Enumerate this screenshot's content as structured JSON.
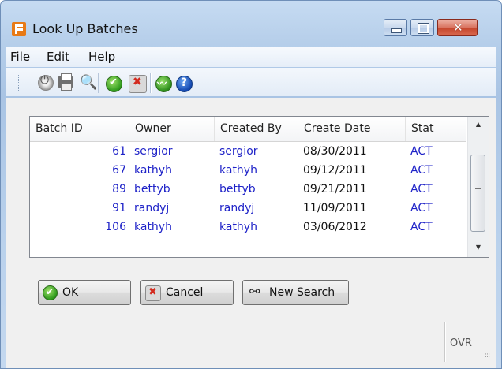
{
  "window": {
    "title": "Look Up Batches",
    "buttons": {
      "minimize": "minimize",
      "maximize": "maximize",
      "close": "✕"
    }
  },
  "menu": [
    "File",
    "Edit",
    "Help"
  ],
  "toolbar": {
    "icons": [
      "power-icon",
      "print-icon",
      "zoom-icon",
      "ok-icon",
      "cancel-icon",
      "chart-icon",
      "help-icon"
    ]
  },
  "table": {
    "columns": [
      "Batch ID",
      "Owner",
      "Created By",
      "Create Date",
      "Stat"
    ],
    "rows": [
      {
        "batch_id": "61",
        "owner": "sergior",
        "created_by": "sergior",
        "create_date": "08/30/2011",
        "stat": "ACT"
      },
      {
        "batch_id": "67",
        "owner": "kathyh",
        "created_by": "kathyh",
        "create_date": "09/12/2011",
        "stat": "ACT"
      },
      {
        "batch_id": "89",
        "owner": "bettyb",
        "created_by": "bettyb",
        "create_date": "09/21/2011",
        "stat": "ACT"
      },
      {
        "batch_id": "91",
        "owner": "randyj",
        "created_by": "randyj",
        "create_date": "11/09/2011",
        "stat": "ACT"
      },
      {
        "batch_id": "106",
        "owner": "kathyh",
        "created_by": "kathyh",
        "create_date": "03/06/2012",
        "stat": "ACT"
      }
    ]
  },
  "buttons": {
    "ok": "OK",
    "cancel": "Cancel",
    "new_search": "New Search"
  },
  "status": {
    "mode": "OVR"
  },
  "colors": {
    "link_text": "#1f23c8",
    "title_bg": "#b4cde9"
  }
}
